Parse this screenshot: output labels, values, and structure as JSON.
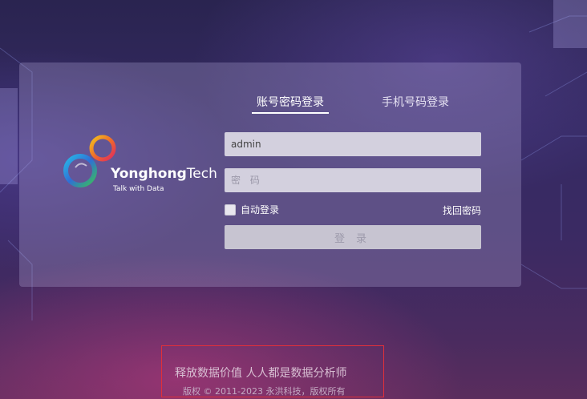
{
  "tabs": {
    "account_login": "账号密码登录",
    "phone_login": "手机号码登录"
  },
  "logo": {
    "brand_bold": "Yonghong",
    "brand_light": "Tech",
    "tagline": "Talk with Data"
  },
  "form": {
    "username_value": "admin",
    "password_placeholder": "密 码",
    "remember_label": "自动登录",
    "forgot_label": "找回密码",
    "login_label": "登录"
  },
  "footer": {
    "slogan": "释放数据价值 人人都是数据分析师",
    "copyright": "版权 © 2011-2023 永洪科技，版权所有"
  },
  "colors": {
    "highlight_border": "#e0303a",
    "input_background": "#d3d0de",
    "panel": "rgba(190,180,225,0.28)"
  }
}
